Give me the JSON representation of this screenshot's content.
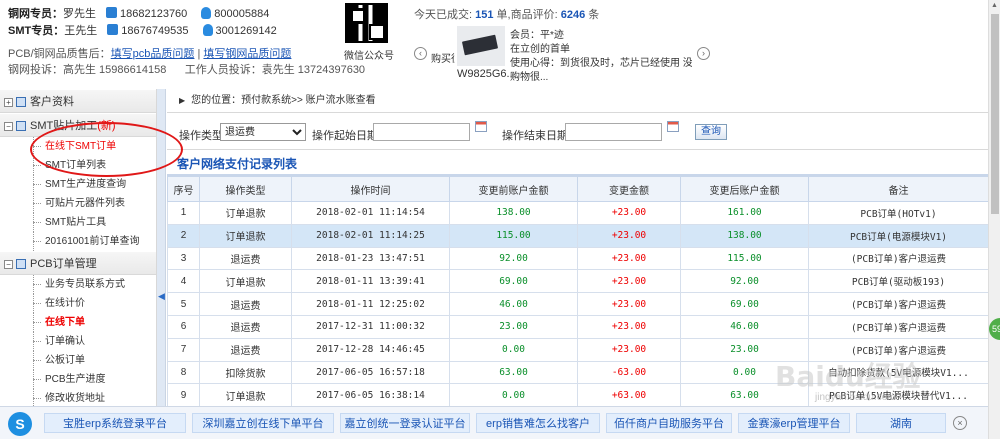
{
  "header": {
    "copper_agent_label": "铜网专员：",
    "copper_agent_name": "罗先生",
    "copper_phone": "18682123760",
    "copper_qq": "800005884",
    "smt_agent_label": "SMT专员：",
    "smt_agent_name": "王先生",
    "smt_phone": "18676749535",
    "smt_qq": "3001269142",
    "quality_supervisor": "PCB/铜网品质售后：",
    "feedback_link_1": "填写pcb品质问题",
    "feedback_sep": "|",
    "feedback_link_2": "填写钢网品质问题",
    "complaint_1": "钢网投诉：高先生 15986614158",
    "complaint_2": "工作人员投诉：袁先生 13724397630",
    "qr_label": "微信公众号",
    "today_prefix": "今天已成交:",
    "today_count": "151",
    "today_mid": "单,商品评价:",
    "review_count": "6246",
    "review_suffix": "条",
    "carousel_left_text": "购买很",
    "product_code": "W9825G6...",
    "review_member": "会员：平*迹",
    "review_line_1": "在立创的首单",
    "review_line_2": "使用心得：到货很及时，芯片已经使用 没有图",
    "review_line_3": "购物很..."
  },
  "sidebar": {
    "groups": [
      {
        "label": "客户资料",
        "badge": ""
      },
      {
        "label": "SMT贴片加工",
        "badge": "(新)"
      },
      {
        "label": "PCB订单管理",
        "badge": ""
      }
    ],
    "smt_items": [
      "在线下SMT订单",
      "SMT订单列表",
      "SMT生产进度查询",
      "可贴片元器件列表",
      "SMT贴片工具",
      "20161001前订单查询"
    ],
    "pcb_items": [
      "业务专员联系方式",
      "在线计价",
      "在线下单",
      "订单确认",
      "公板订单",
      "PCB生产进度",
      "修改收货地址"
    ]
  },
  "breadcrumb": {
    "text": "您的位置：预付款系统>> 账户流水账查看"
  },
  "filter": {
    "type_label": "操作类型:",
    "type_value": "退运费",
    "start_label": "操作起始日期:",
    "end_label": "操作结束日期:",
    "query_button": "查询"
  },
  "table": {
    "title": "客户网络支付记录列表",
    "headers": [
      "序号",
      "操作类型",
      "操作时间",
      "变更前账户金额",
      "变更金额",
      "变更后账户金额",
      "备注"
    ],
    "rows": [
      {
        "no": "1",
        "type": "订单退款",
        "time": "2018-02-01 11:14:54",
        "before": "138.00",
        "change": "+23.00",
        "after": "161.00",
        "note": "PCB订单(HOTv1)"
      },
      {
        "no": "2",
        "type": "订单退款",
        "time": "2018-02-01 11:14:25",
        "before": "115.00",
        "change": "+23.00",
        "after": "138.00",
        "note": "PCB订单(电源模块V1)"
      },
      {
        "no": "3",
        "type": "退运费",
        "time": "2018-01-23 13:47:51",
        "before": "92.00",
        "change": "+23.00",
        "after": "115.00",
        "note": "(PCB订单)客户退运费"
      },
      {
        "no": "4",
        "type": "订单退款",
        "time": "2018-01-11 13:39:41",
        "before": "69.00",
        "change": "+23.00",
        "after": "92.00",
        "note": "PCB订单(驱动板193)"
      },
      {
        "no": "5",
        "type": "退运费",
        "time": "2018-01-11 12:25:02",
        "before": "46.00",
        "change": "+23.00",
        "after": "69.00",
        "note": "(PCB订单)客户退运费"
      },
      {
        "no": "6",
        "type": "退运费",
        "time": "2017-12-31 11:00:32",
        "before": "23.00",
        "change": "+23.00",
        "after": "46.00",
        "note": "(PCB订单)客户退运费"
      },
      {
        "no": "7",
        "type": "退运费",
        "time": "2017-12-28 14:46:45",
        "before": "0.00",
        "change": "+23.00",
        "after": "23.00",
        "note": "(PCB订单)客户退运费"
      },
      {
        "no": "8",
        "type": "扣除货款",
        "time": "2017-06-05 16:57:18",
        "before": "63.00",
        "change": "-63.00",
        "after": "0.00",
        "note": "自动扣除货款(5V电源模块V1..."
      },
      {
        "no": "9",
        "type": "订单退款",
        "time": "2017-06-05 16:38:14",
        "before": "0.00",
        "change": "+63.00",
        "after": "63.00",
        "note": "PCB订单(5V电源模块替代V1..."
      }
    ]
  },
  "bottombar": {
    "logo": "S",
    "links": [
      "宝胜erp系统登录平台",
      "深圳嘉立创在线下单平台",
      "嘉立创统一登录认证平台",
      "erp销售难怎么找客户",
      "佰仟商户自助服务平台",
      "金赛濠erp管理平台",
      "湖南"
    ]
  },
  "watermark": {
    "main": "Baidu经验",
    "sub": "jingyan.baidu.com"
  },
  "float_badge": "59",
  "colors": {
    "link_blue": "#1a55b5",
    "positive_green": "#0a8f2a",
    "change_red": "#e00000",
    "annotation_red": "#e01818"
  }
}
